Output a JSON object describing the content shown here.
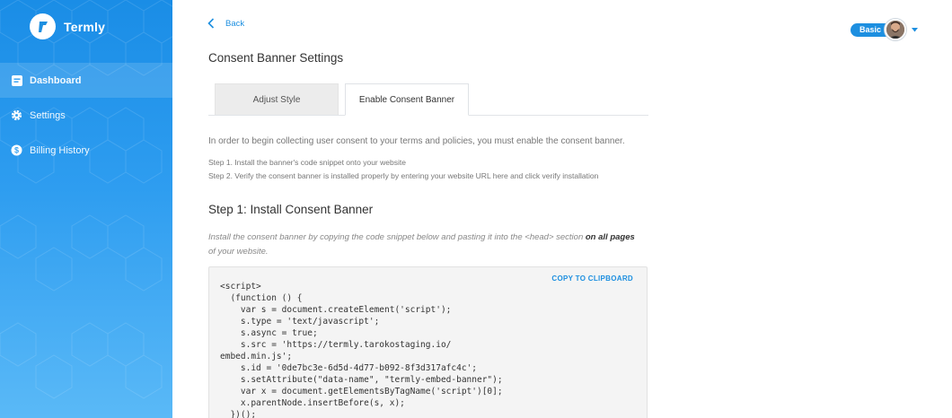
{
  "brand": {
    "name": "Termly"
  },
  "sidebar": {
    "items": [
      {
        "label": "Dashboard",
        "icon": "dashboard-icon",
        "active": true
      },
      {
        "label": "Settings",
        "icon": "gear-icon",
        "active": false
      },
      {
        "label": "Billing History",
        "icon": "dollar-icon",
        "active": false
      }
    ]
  },
  "header": {
    "back_label": "Back",
    "title": "Consent Banner Settings",
    "plan_label": "Basic"
  },
  "tabs": [
    {
      "label": "Adjust Style",
      "active": false
    },
    {
      "label": "Enable Consent Banner",
      "active": true
    }
  ],
  "content": {
    "intro": "In order to begin collecting user consent to your terms and policies, you must enable the consent banner.",
    "step1": "Step 1.  Install the banner's code snippet onto your website",
    "step2": "Step 2.  Verify the consent banner is installed properly by entering your website URL here and click verify installation",
    "section_title": "Step 1: Install Consent Banner",
    "hint_prefix": "Install the consent banner by copying the code snippet below and pasting it into the <head> section ",
    "hint_bold": "on all pages",
    "hint_suffix": " of your website.",
    "copy_label": "COPY TO CLIPBOARD",
    "code": "<script>\n  (function () {\n    var s = document.createElement('script');\n    s.type = 'text/javascript';\n    s.async = true;\n    s.src = 'https://termly.tarokostaging.io/\nembed.min.js';\n    s.id = '0de7bc3e-6d5d-4d77-b092-8f3d317afc4c';\n    s.setAttribute(\"data-name\", \"termly-embed-banner\");\n    var x = document.getElementsByTagName('script')[0];\n    x.parentNode.insertBefore(s, x);\n  })();"
  },
  "colors": {
    "accent": "#1d8fe0",
    "sidebar_top": "#1a8de6",
    "sidebar_bottom": "#5ab9f7"
  }
}
